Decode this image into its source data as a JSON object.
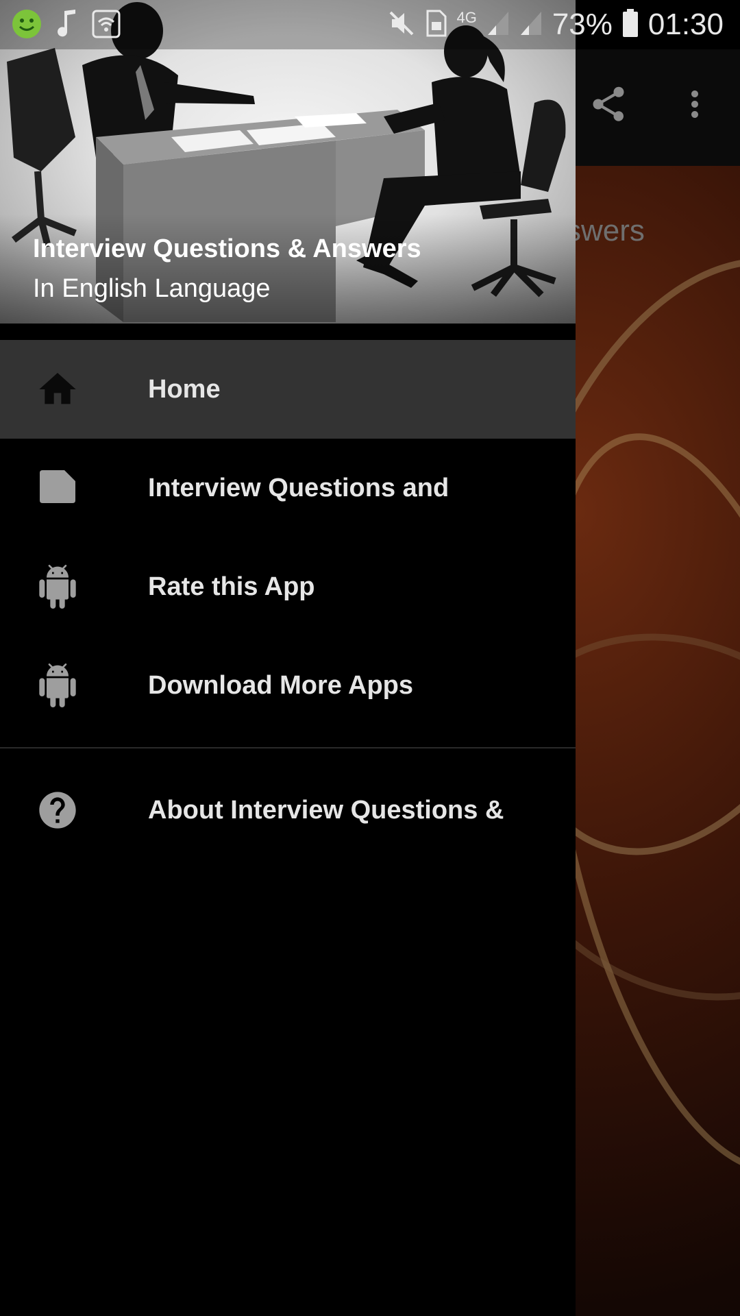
{
  "status_bar": {
    "battery_percent": "73%",
    "time": "01:30",
    "network_type": "4G",
    "icons_left": [
      "smiley-app-icon",
      "music-note-icon",
      "wifi-box-icon"
    ],
    "icons_right": [
      "mute-icon",
      "sim-icon",
      "signal-icon",
      "signal-icon-2",
      "battery-icon"
    ]
  },
  "drawer": {
    "header": {
      "title": "Interview Questions & Answers",
      "subtitle": "In English Language"
    },
    "items": [
      {
        "label": "Home",
        "icon": "home-icon",
        "active": true
      },
      {
        "label": "Interview Questions and",
        "icon": "note-icon",
        "active": false
      },
      {
        "label": "Rate this App",
        "icon": "android-icon",
        "active": false
      },
      {
        "label": "Download More Apps",
        "icon": "android-icon",
        "active": false
      }
    ],
    "footer_items": [
      {
        "label": "About Interview Questions &",
        "icon": "help-circle-icon"
      }
    ]
  },
  "background_app": {
    "content_title_fragment": "swers",
    "actions": [
      "share-icon",
      "more-vert-icon"
    ]
  },
  "colors": {
    "drawer_bg": "#000000",
    "active_item_bg": "#333333",
    "icon_gray": "#9e9e9e",
    "text": "#e6e6e6"
  }
}
